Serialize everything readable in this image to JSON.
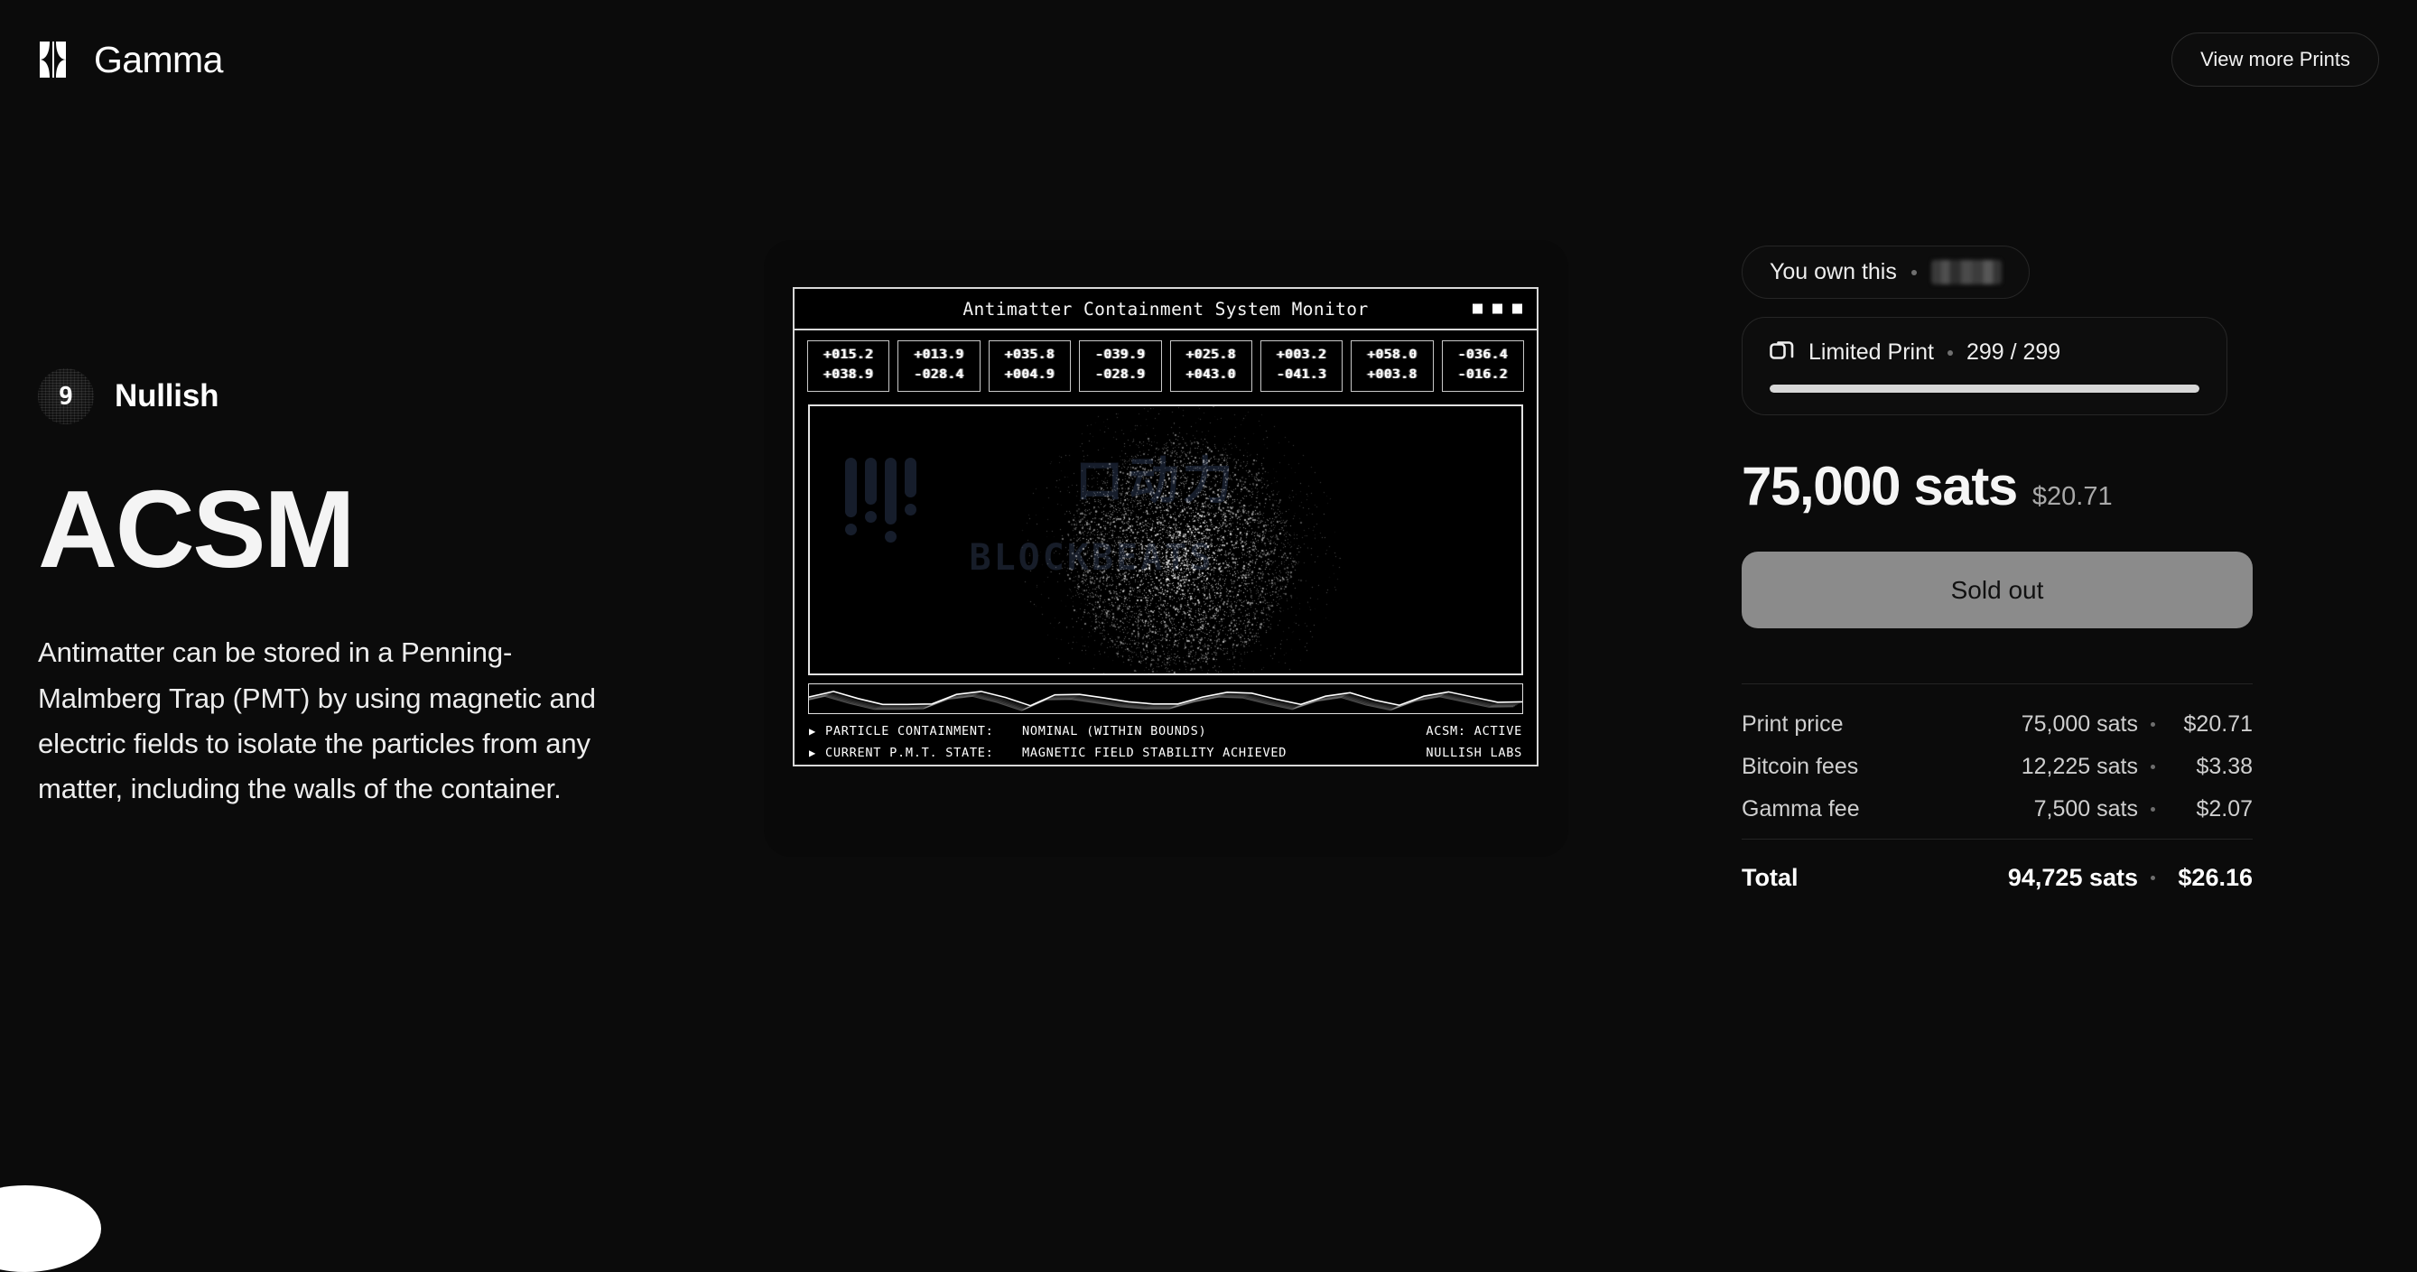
{
  "header": {
    "brand_name": "Gamma",
    "brand_logo_name": "gamma-logo",
    "view_more_label": "View more Prints"
  },
  "artist": {
    "name": "Nullish",
    "avatar_glyph": "9"
  },
  "artwork": {
    "title": "ACSM",
    "description": "Antimatter can be stored in a Penning-Malmberg Trap (PMT) by using magnetic and electric fields to isolate the particles from any matter, including the walls of the container."
  },
  "terminal": {
    "title": "Antimatter Containment System Monitor",
    "readouts": [
      {
        "line1": "+015.2",
        "line2": "+038.9"
      },
      {
        "line1": "+013.9",
        "line2": "-028.4"
      },
      {
        "line1": "+035.8",
        "line2": "+004.9"
      },
      {
        "line1": "-039.9",
        "line2": "-028.9"
      },
      {
        "line1": "+025.8",
        "line2": "+043.0"
      },
      {
        "line1": "+003.2",
        "line2": "-041.3"
      },
      {
        "line1": "+058.0",
        "line2": "+003.8"
      },
      {
        "line1": "-036.4",
        "line2": "-016.2"
      }
    ],
    "watermark": {
      "japanese": "ロ动力",
      "text": "BLOCKBEATS"
    },
    "status": [
      {
        "arrow": "▶",
        "label": "PARTICLE CONTAINMENT:",
        "value": "NOMINAL (WITHIN BOUNDS)",
        "right": "ACSM: ACTIVE"
      },
      {
        "arrow": "▶",
        "label": "CURRENT P.M.T. STATE:",
        "value": "MAGNETIC FIELD STABILITY ACHIEVED",
        "right": "NULLISH LABS"
      }
    ],
    "waveform": [
      62,
      88,
      55,
      28,
      28,
      30,
      74,
      88,
      60,
      22,
      72,
      74,
      58,
      40,
      30,
      30,
      62,
      84,
      80,
      52,
      28,
      66,
      82,
      48,
      24,
      66,
      86,
      62,
      38,
      40
    ]
  },
  "ownership": {
    "own_label": "You own this",
    "owner_redacted": true,
    "print_type": "Limited Print",
    "print_count": "299 / 299",
    "progress_percent": 100
  },
  "price": {
    "sats": "75,000 sats",
    "fiat": "$20.71"
  },
  "cta": {
    "label": "Sold out",
    "disabled": true
  },
  "fees": {
    "rows": [
      {
        "label": "Print price",
        "sats": "75,000 sats",
        "usd": "$20.71"
      },
      {
        "label": "Bitcoin fees",
        "sats": "12,225 sats",
        "usd": "$3.38"
      },
      {
        "label": "Gamma fee",
        "sats": "7,500 sats",
        "usd": "$2.07"
      }
    ],
    "total": {
      "label": "Total",
      "sats": "94,725 sats",
      "usd": "$26.16"
    }
  },
  "colors": {
    "background": "#0b0b0b",
    "card": "#090909",
    "terminal_border": "#d8d8d8",
    "sold_out_button": "#8b8b8b",
    "progress_fill": "#d7d7d7",
    "watermark": "#161d2b"
  }
}
